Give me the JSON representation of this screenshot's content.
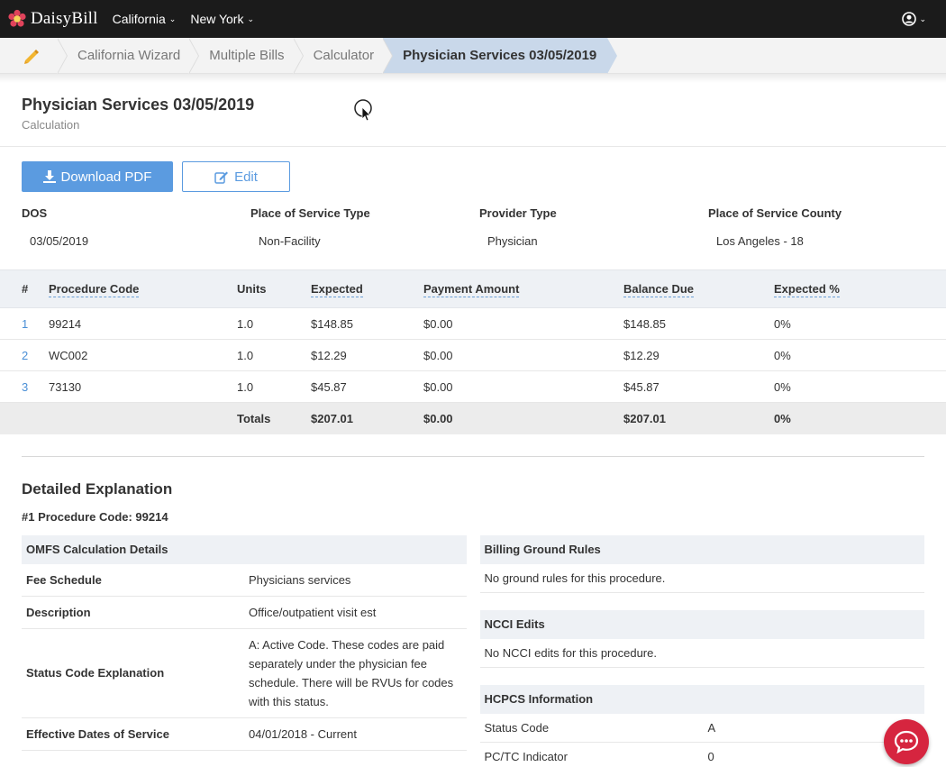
{
  "nav": {
    "brand": "DaisyBill",
    "links": [
      "California",
      "New York"
    ]
  },
  "breadcrumb": [
    "California Wizard",
    "Multiple Bills",
    "Calculator",
    "Physician Services 03/05/2019"
  ],
  "header": {
    "title": "Physician Services 03/05/2019",
    "subtitle": "Calculation"
  },
  "actions": {
    "download_label": "Download PDF",
    "edit_label": "Edit"
  },
  "info": [
    {
      "label": "DOS",
      "value": "03/05/2019"
    },
    {
      "label": "Place of Service Type",
      "value": "Non-Facility"
    },
    {
      "label": "Provider Type",
      "value": "Physician"
    },
    {
      "label": "Place of Service County",
      "value": "Los Angeles - 18"
    }
  ],
  "table": {
    "headers": [
      "#",
      "Procedure Code",
      "Units",
      "Expected",
      "Payment Amount",
      "Balance Due",
      "Expected %"
    ],
    "rows": [
      [
        "1",
        "99214",
        "1.0",
        "$148.85",
        "$0.00",
        "$148.85",
        "0%"
      ],
      [
        "2",
        "WC002",
        "1.0",
        "$12.29",
        "$0.00",
        "$12.29",
        "0%"
      ],
      [
        "3",
        "73130",
        "1.0",
        "$45.87",
        "$0.00",
        "$45.87",
        "0%"
      ]
    ],
    "totals": [
      "Totals",
      "$207.01",
      "$0.00",
      "$207.01",
      "0%"
    ]
  },
  "detail": {
    "title": "Detailed Explanation",
    "subtitle": "#1 Procedure Code: 99214",
    "omfs": {
      "header": "OMFS Calculation Details",
      "rows": [
        {
          "k": "Fee Schedule",
          "v": "Physicians services"
        },
        {
          "k": "Description",
          "v": "Office/outpatient visit est"
        },
        {
          "k": "Status Code Explanation",
          "v": "A: Active Code. These codes are paid separately under the physician fee schedule. There will be RVUs for codes with this status."
        },
        {
          "k": "Effective Dates of Service",
          "v": "04/01/2018 - Current"
        }
      ]
    },
    "ground_rules": {
      "header": "Billing Ground Rules",
      "body": "No ground rules for this procedure."
    },
    "ncci": {
      "header": "NCCI Edits",
      "body": "No NCCI edits for this procedure."
    },
    "hcpcs": {
      "header": "HCPCS Information",
      "rows": [
        {
          "k": "Status Code",
          "v": "A"
        },
        {
          "k": "PC/TC Indicator",
          "v": "0"
        }
      ]
    }
  },
  "colors": {
    "nav_bg": "#1b1b1b",
    "accent": "#5b9be0",
    "active_crumb": "#c9d8ea",
    "chat": "#d6253f"
  }
}
